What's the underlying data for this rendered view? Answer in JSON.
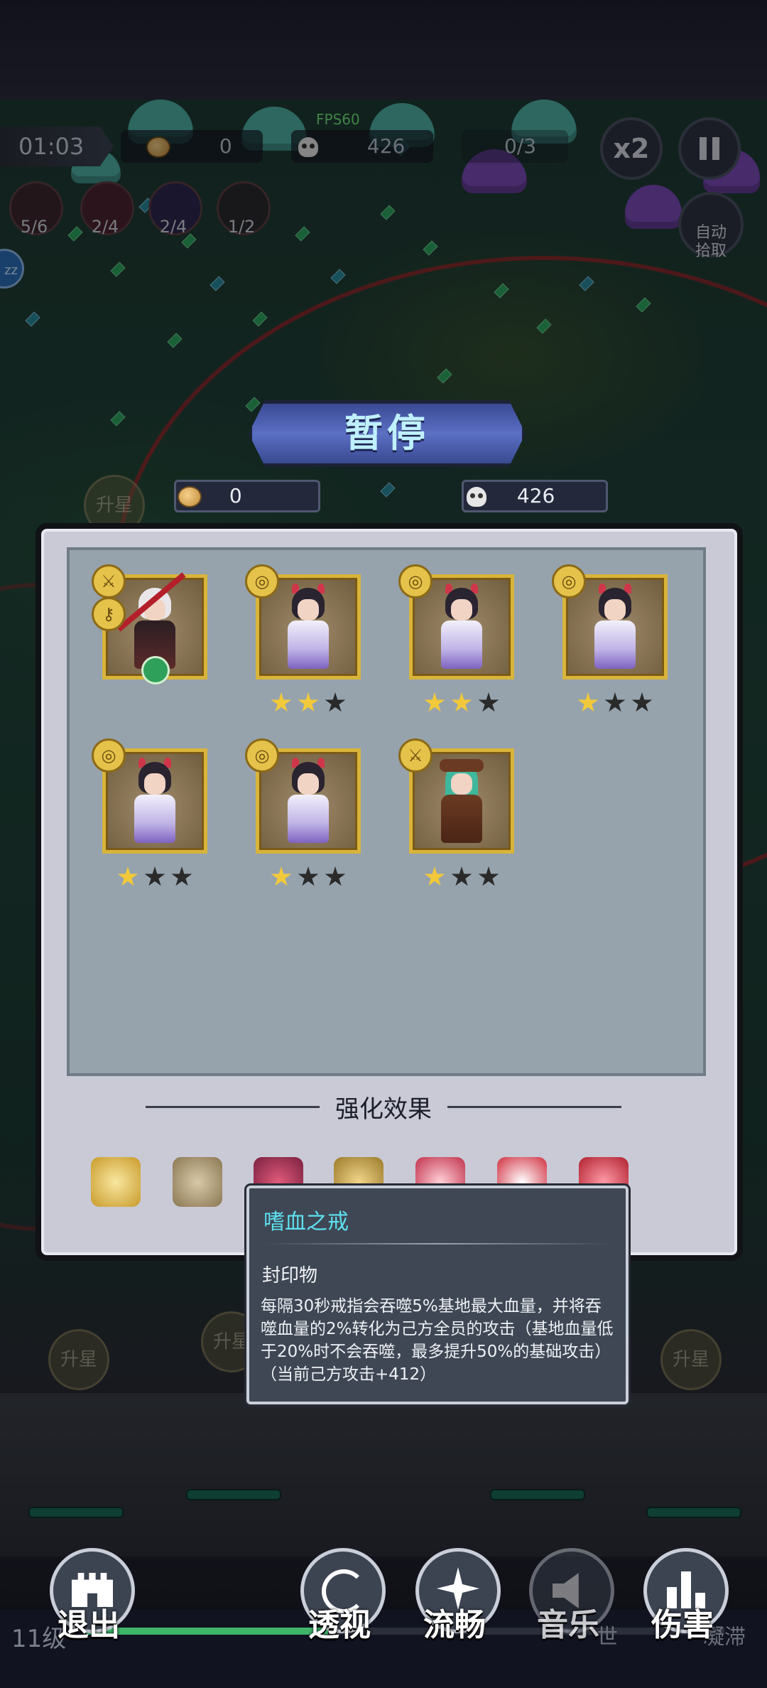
{
  "hud": {
    "timer": "01:03",
    "coins": "0",
    "kills": "426",
    "wave": "0/3",
    "fps": "FPS60",
    "speed_label": "x2",
    "auto_pick_label": "自动\n拾取",
    "side_badge": "zz"
  },
  "skills": [
    {
      "count": "5/6",
      "color": "#b0483c"
    },
    {
      "count": "2/4",
      "color": "#b03a48"
    },
    {
      "count": "2/4",
      "color": "#6a4fb0"
    },
    {
      "count": "1/2",
      "color": "#4a4a4a"
    }
  ],
  "pause": {
    "title": "暂停",
    "coins": "0",
    "kills": "426"
  },
  "heroes_grid": [
    {
      "name": "scythe-hero",
      "badges": [
        "sword",
        "key"
      ],
      "stars": 0,
      "has_stars": false
    },
    {
      "name": "demon-hero",
      "badges": [
        "swirl"
      ],
      "stars": 2,
      "has_stars": true
    },
    {
      "name": "demon-hero",
      "badges": [
        "swirl"
      ],
      "stars": 2,
      "has_stars": true
    },
    {
      "name": "demon-hero",
      "badges": [
        "swirl"
      ],
      "stars": 1,
      "has_stars": true
    },
    {
      "name": "demon-hero",
      "badges": [
        "swirl"
      ],
      "stars": 1,
      "has_stars": true
    },
    {
      "name": "demon-hero",
      "badges": [
        "swirl"
      ],
      "stars": 1,
      "has_stars": true
    },
    {
      "name": "hunter-hero",
      "badges": [
        "sword"
      ],
      "stars": 1,
      "has_stars": true
    }
  ],
  "strengthen": {
    "title": "强化效果",
    "icons": [
      "shield-cross-icon",
      "crossbow-icon",
      "ring-icon",
      "book-icon",
      "claw-icon",
      "blade-icon",
      "red-blade-icon"
    ]
  },
  "tooltip": {
    "name": "嗜血之戒",
    "type": "封印物",
    "description": "每隔30秒戒指会吞噬5%基地最大血量，并将吞噬血量的2%转化为己方全员的攻击（基地血量低于20%时不会吞噬，最多提升50%的基础攻击）（当前己方攻击+412）"
  },
  "battle": {
    "upgrade_label": "升星",
    "level": "11级",
    "faint_right_1": "世",
    "faint_right_2": "凝滞"
  },
  "bottom_buttons": [
    {
      "label": "退出",
      "icon": "castle-icon"
    },
    {
      "label": "透视",
      "icon": "swirl-icon"
    },
    {
      "label": "流畅",
      "icon": "sparkle-icon"
    },
    {
      "label": "音乐",
      "icon": "speaker-icon"
    },
    {
      "label": "伤害",
      "icon": "bar-chart-icon"
    }
  ]
}
